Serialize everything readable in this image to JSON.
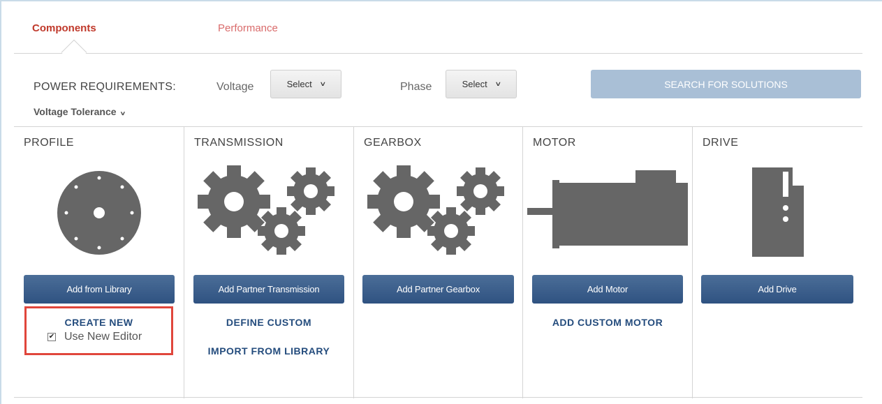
{
  "tabs": {
    "components": "Components",
    "performance": "Performance"
  },
  "power": {
    "label": "POWER REQUIREMENTS:",
    "voltage_label": "Voltage",
    "voltage_value": "Select",
    "phase_label": "Phase",
    "phase_value": "Select",
    "search_button": "SEARCH FOR SOLUTIONS",
    "tolerance": "Voltage Tolerance"
  },
  "columns": {
    "profile": {
      "title": "PROFILE",
      "button": "Add from Library",
      "link1": "CREATE NEW",
      "checkbox_label": "Use New Editor",
      "checkbox_checked": true
    },
    "transmission": {
      "title": "TRANSMISSION",
      "button": "Add Partner Transmission",
      "link1": "DEFINE CUSTOM",
      "link2": "IMPORT FROM LIBRARY"
    },
    "gearbox": {
      "title": "GEARBOX",
      "button": "Add Partner Gearbox"
    },
    "motor": {
      "title": "MOTOR",
      "button": "Add Motor",
      "link1": "ADD CUSTOM MOTOR"
    },
    "drive": {
      "title": "DRIVE",
      "button": "Add Drive"
    }
  },
  "colors": {
    "accent_red": "#c0392b",
    "button_blue": "#2f5281",
    "link_blue": "#244c7d",
    "icon_gray": "#666666",
    "highlight_red": "#e0463c"
  },
  "icons": [
    "profile-disc-icon",
    "gears-icon",
    "motor-icon",
    "drive-icon",
    "checkbox-icon",
    "chevron-down-icon"
  ]
}
